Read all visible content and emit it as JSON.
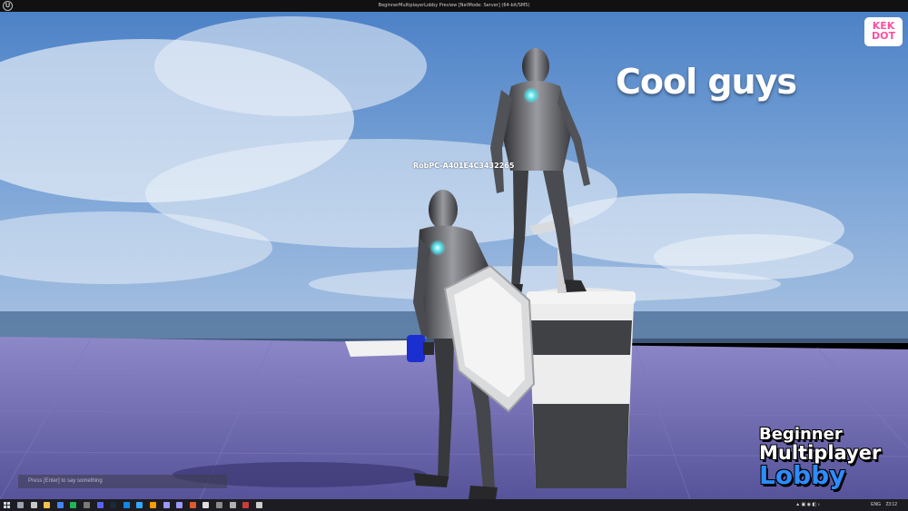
{
  "window": {
    "title": "BeginnerMultiplayerLobby Preview [NetMode: Server]  (64-bit/SM5)"
  },
  "overlay": {
    "caption": "Cool guys",
    "player_name": "RobPC-A401E4C3432265",
    "chat_placeholder": "Press [Enter] to say something",
    "brand_line1": "KEK",
    "brand_line2": "DOT"
  },
  "logo": {
    "line1": "Beginner",
    "line2": "Multiplayer",
    "line3": "Lobby"
  },
  "taskbar": {
    "icons": [
      "search-icon",
      "task-view-icon",
      "file-explorer-icon",
      "chrome-icon",
      "spotify-icon",
      "app-icon",
      "discord-icon",
      "steam-icon",
      "vs-code-icon",
      "photoshop-icon",
      "illustrator-icon",
      "premiere-icon",
      "after-effects-icon",
      "media-icon",
      "unreal-engine-icon",
      "obs-icon",
      "app-icon",
      "app-icon",
      "app-icon"
    ],
    "language": "ENG",
    "time": "23:12"
  },
  "colors": {
    "accent_blue": "#2d8cff",
    "brand_pink": "#ff4fa0",
    "floor": "#6e6aa8"
  }
}
